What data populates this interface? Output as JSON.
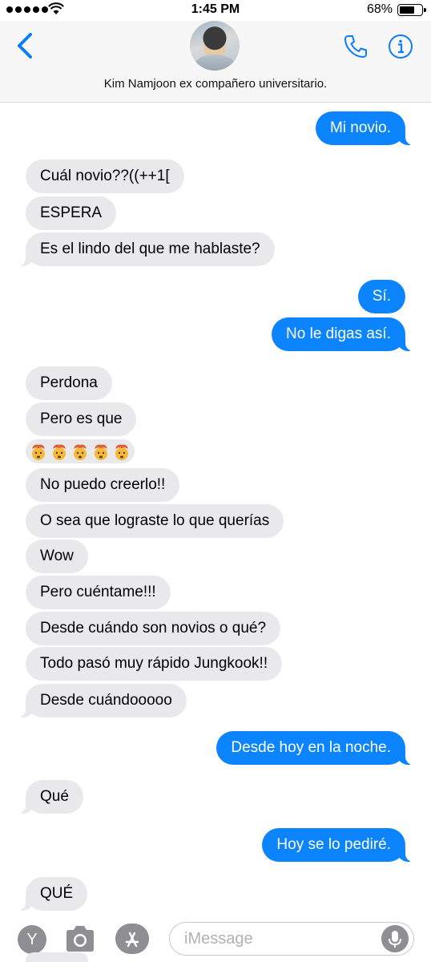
{
  "status_bar": {
    "time": "1:45 PM",
    "battery": "68%"
  },
  "header": {
    "contact_name": "Kim Namjoon ex compañero universitario."
  },
  "messages": [
    {
      "dir": "out",
      "text": "Mi novio."
    },
    {
      "dir": "in",
      "text": "Cuál novio??((++1["
    },
    {
      "dir": "in",
      "text": "ESPERA"
    },
    {
      "dir": "in",
      "text": "Es el lindo del que me hablaste?"
    },
    {
      "dir": "out",
      "text": "Sí."
    },
    {
      "dir": "out",
      "text": "No le digas así."
    },
    {
      "dir": "in",
      "text": "Perdona"
    },
    {
      "dir": "in",
      "text": "Pero es que"
    },
    {
      "dir": "in",
      "text": "No puedo creerlo!!"
    },
    {
      "dir": "in",
      "text": "O sea que lograste lo que querías"
    },
    {
      "dir": "in",
      "text": "Wow"
    },
    {
      "dir": "in",
      "text": "Pero cuéntame!!!"
    },
    {
      "dir": "in",
      "text": "Desde cuándo son novios o qué?"
    },
    {
      "dir": "in",
      "text": "Todo pasó muy rápido Jungkook!!"
    },
    {
      "dir": "in",
      "text": "Desde cuándooooo"
    },
    {
      "dir": "out",
      "text": "Desde hoy en la noche."
    },
    {
      "dir": "in",
      "text": "Qué"
    },
    {
      "dir": "out",
      "text": "Hoy se lo pediré."
    },
    {
      "dir": "in",
      "text": "QUÉ"
    }
  ],
  "emoji_message": {
    "icon": "exploding-head-emoji",
    "count": 5
  },
  "input_bar": {
    "apps_label": "Y",
    "placeholder": "iMessage"
  },
  "colors": {
    "outgoing": "#0b84fe",
    "incoming": "#e9e9eb",
    "accent": "#0b7cff"
  }
}
